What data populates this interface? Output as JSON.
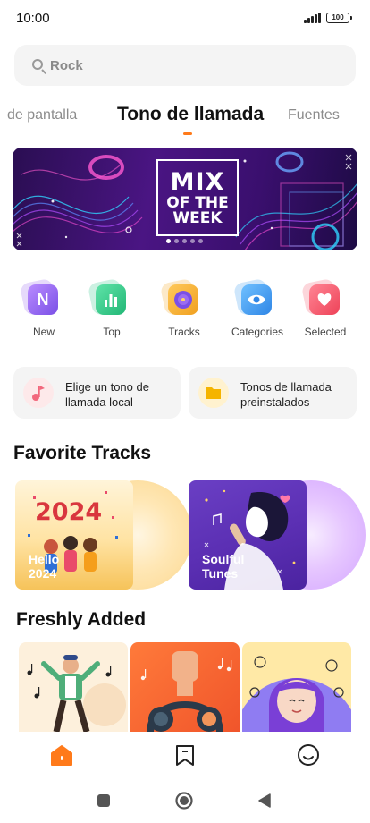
{
  "status_bar": {
    "time": "10:00",
    "battery": "100"
  },
  "search": {
    "placeholder": "Rock"
  },
  "tabs": [
    {
      "label": "de pantalla"
    },
    {
      "label": "Tono de llamada"
    },
    {
      "label": "Fuentes"
    }
  ],
  "banner": {
    "line1": "MIX",
    "line2": "OF THE WEEK"
  },
  "categories": [
    {
      "label": "New",
      "icon": "new-icon",
      "color": "#9b6cf0"
    },
    {
      "label": "Top",
      "icon": "top-chart-icon",
      "color": "#35c98a"
    },
    {
      "label": "Tracks",
      "icon": "vinyl-icon",
      "color": "#f5a623"
    },
    {
      "label": "Categories",
      "icon": "eye-icon",
      "color": "#3c9df0"
    },
    {
      "label": "Selected",
      "icon": "heart-icon",
      "color": "#f45b6e"
    }
  ],
  "quick_tiles": [
    {
      "line1": "Elige un tono de",
      "line2": "llamada local",
      "icon": "music-note-icon"
    },
    {
      "line1": "Tonos de llamada",
      "line2": "preinstalados",
      "icon": "folder-icon"
    }
  ],
  "favorite_tracks": {
    "title": "Favorite Tracks",
    "items": [
      {
        "name_line1": "Hello",
        "name_line2": "2024",
        "cover_text": "2024"
      },
      {
        "name_line1": "Soulful",
        "name_line2": "Tunes"
      }
    ]
  },
  "freshly_added": {
    "title": "Freshly Added"
  },
  "bottom_nav": [
    {
      "icon": "home-icon"
    },
    {
      "icon": "bookmark-icon"
    },
    {
      "icon": "smiley-icon"
    }
  ],
  "system_nav": [
    {
      "icon": "recents-square-icon"
    },
    {
      "icon": "home-circle-icon"
    },
    {
      "icon": "back-triangle-icon"
    }
  ],
  "colors": {
    "accent": "#ff7a1a",
    "banner_bg": "#3a0f6e",
    "tile_bg": "#f4f4f4"
  }
}
